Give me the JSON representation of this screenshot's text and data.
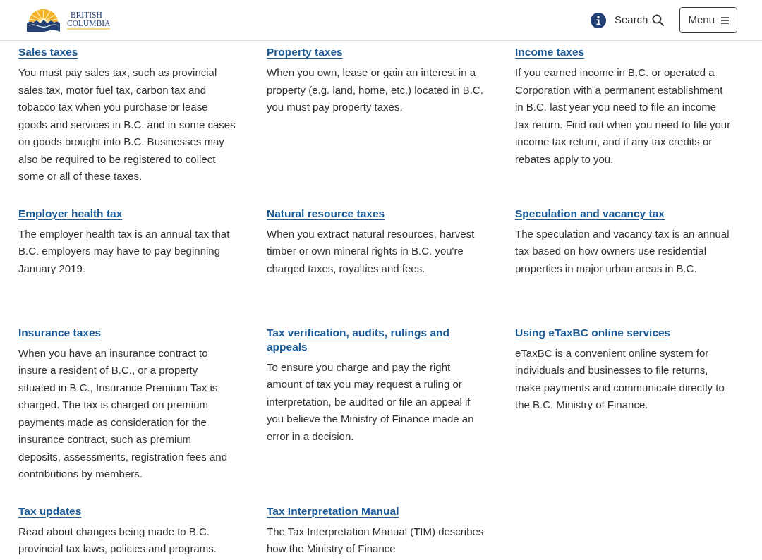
{
  "header": {
    "logo": {
      "line_1": "BRITISH",
      "line_2": "COLUMBIA"
    },
    "search_label": "Search",
    "menu_label": "Menu"
  },
  "topics": [
    {
      "title": "Sales taxes",
      "description": "You must pay sales tax, such as provincial sales tax, motor fuel tax, carbon tax and tobacco tax when you purchase or lease goods and services in B.C. and in some cases on goods brought into B.C. Businesses may also be required to be registered to collect some or all of these taxes."
    },
    {
      "title": "Property taxes",
      "description": "When you own, lease or gain an interest in a property (e.g. land, home, etc.) located in B.C. you must pay property taxes."
    },
    {
      "title": "Income taxes",
      "description": "If you earned income in B.C. or operated a Corporation with a permanent establishment in B.C. last year you need to file an income tax return. Find out when you need to file your income tax return, and if any tax credits or rebates apply to you."
    },
    {
      "title": "Employer health tax",
      "description": "The employer health tax is an annual tax that B.C. employers may have to pay beginning January 2019."
    },
    {
      "title": "Natural resource taxes",
      "description": "When you extract natural resources, harvest timber or own mineral rights in B.C. you're charged taxes, royalties and fees."
    },
    {
      "title": "Speculation and vacancy tax",
      "description": "The speculation and vacancy tax is an annual tax based on how owners use residential properties in major urban areas in B.C."
    },
    {
      "title": "Insurance taxes",
      "description": "When you have an insurance contract to insure a resident of B.C., or a property situated in B.C., Insurance Premium Tax is charged. The tax is charged on premium payments made as consideration for the insurance contract, such as premium deposits, assessments, registration fees and contributions by members."
    },
    {
      "title": "Tax verification, audits, rulings and appeals",
      "description": "To ensure you charge and pay the right amount of tax you may request a ruling or interpretation, be audited or file an appeal if you believe the Ministry of Finance made an error in a decision."
    },
    {
      "title": "Using eTaxBC online services",
      "description": "eTaxBC is a convenient online system for individuals and businesses to file returns, make payments and communicate directly to the B.C. Ministry of Finance."
    },
    {
      "title": "Tax updates",
      "description": "Read about changes being made to B.C. provincial tax laws, policies and programs."
    },
    {
      "title": "Tax Interpretation Manual",
      "description": "The Tax Interpretation Manual (TIM) describes how the Ministry of Finance"
    }
  ]
}
